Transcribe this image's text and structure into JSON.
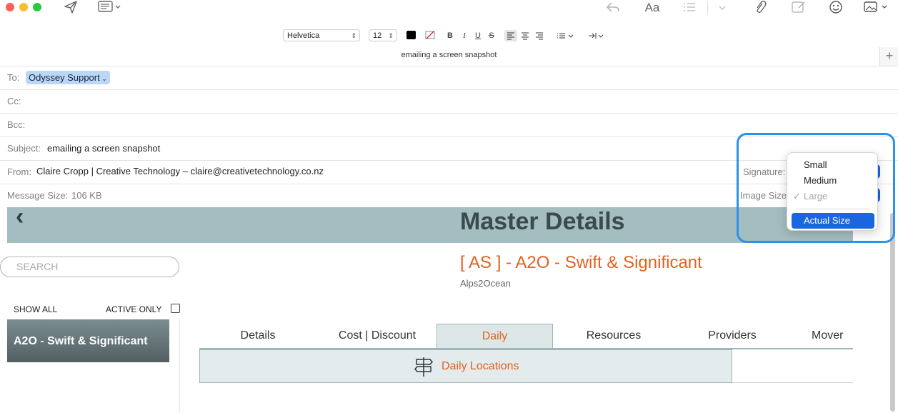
{
  "format_bar": {
    "font": "Helvetica",
    "size": "12",
    "bold": "B",
    "italic": "I",
    "underline": "U",
    "strike": "S"
  },
  "tab_title": "emailing a screen snapshot",
  "toolbar": {
    "format_label": "Aa"
  },
  "headers": {
    "to_label": "To:",
    "to_recipient": "Odyssey Support",
    "cc_label": "Cc:",
    "bcc_label": "Bcc:",
    "subject_label": "Subject:",
    "subject_value": "emailing a screen snapshot",
    "from_label": "From:",
    "from_value": "Claire Cropp | Creative Technology – claire@creativetechnology.co.nz",
    "size_label": "Message Size:",
    "size_value": "106 KB",
    "signature_label": "Signature:",
    "image_size_label": "Image Size"
  },
  "image_size_menu": {
    "items": [
      "Small",
      "Medium",
      "Large",
      "Actual Size"
    ],
    "checked": "Large",
    "selected": "Actual Size"
  },
  "snapshot": {
    "banner_title": "Master Details",
    "search_placeholder": "SEARCH",
    "tour_title": "[ AS ] - A2O - Swift & Significant",
    "tour_subtitle": "Alps2Ocean",
    "show_all": "SHOW ALL",
    "active_only": "ACTIVE ONLY",
    "list_item": "A2O - Swift & Significant",
    "tabs": [
      "Details",
      "Cost | Discount",
      "Daily",
      "Resources",
      "Providers",
      "Mover"
    ],
    "active_tab": "Daily",
    "sub_panel": "Daily Locations"
  },
  "colors": {
    "accent_orange": "#e0621e",
    "banner": "#a4bdc0",
    "highlight_blue": "#2a93e8",
    "menu_selected": "#1a66e0"
  }
}
